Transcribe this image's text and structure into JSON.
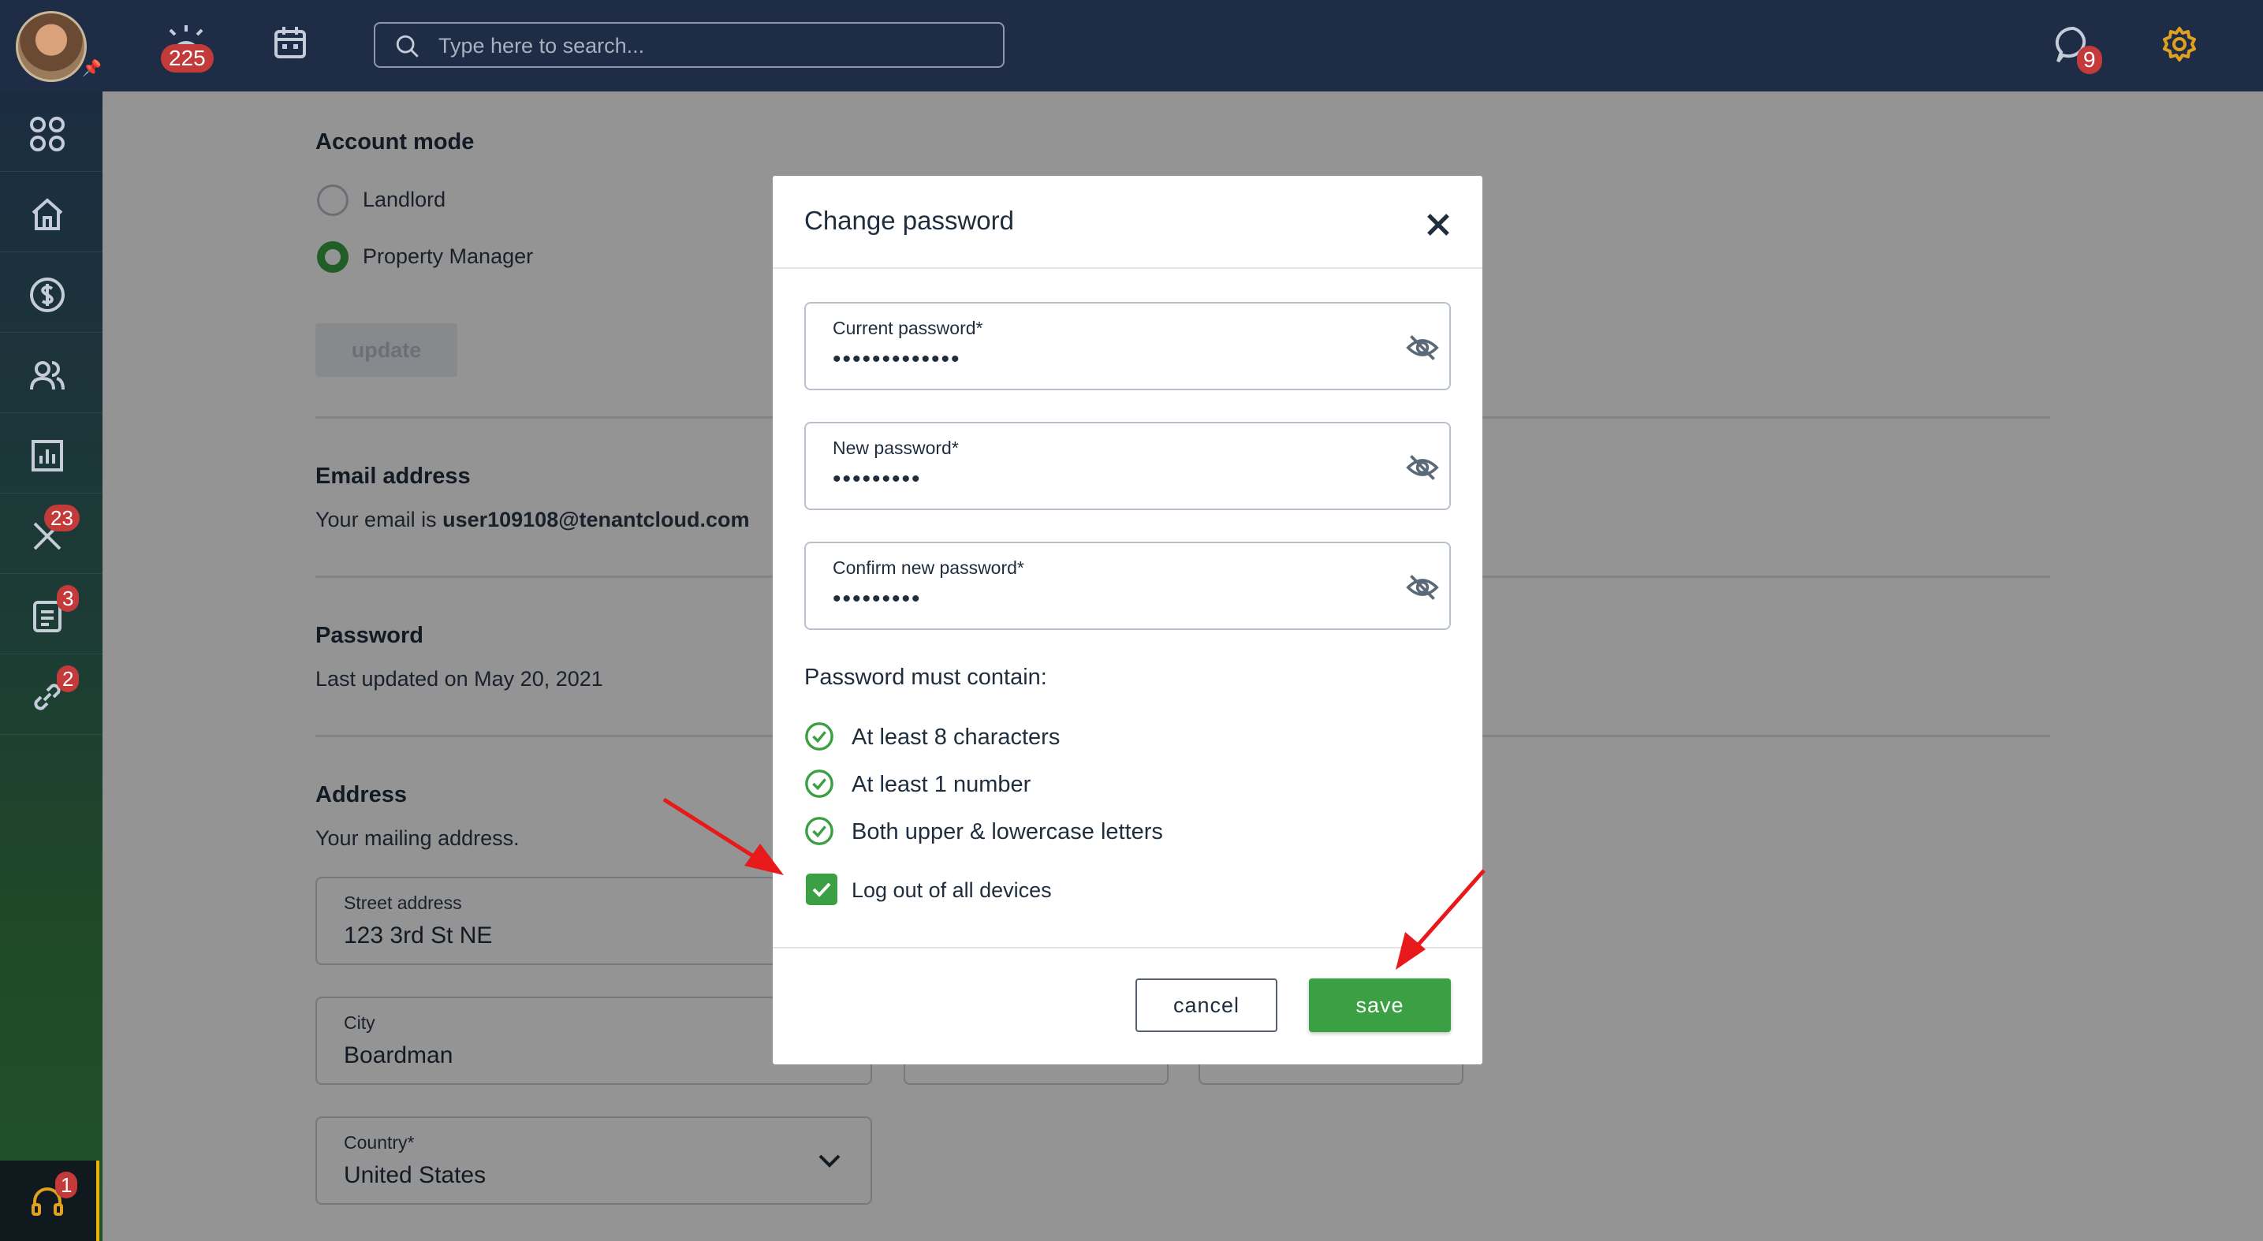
{
  "topbar": {
    "alerts_count": "225",
    "search_placeholder": "Type here to search...",
    "messages_count": "9"
  },
  "sidebar": {
    "maintenance_count": "23",
    "documents_count": "3",
    "links_count": "2",
    "help_count": "1"
  },
  "account_mode": {
    "title": "Account mode",
    "options": [
      "Landlord",
      "Property Manager"
    ],
    "selected": "Property Manager",
    "update_label": "update"
  },
  "email": {
    "title": "Email address",
    "prefix": "Your email is ",
    "value": "user109108@tenantcloud.com"
  },
  "password_section": {
    "title": "Password",
    "last_updated": "Last updated on May 20, 2021"
  },
  "address": {
    "title": "Address",
    "subtitle": "Your mailing address.",
    "street_label": "Street address",
    "street_value": "123 3rd St NE",
    "city_label": "City",
    "city_value": "Boardman",
    "country_label": "Country*",
    "country_value": "United States"
  },
  "modal": {
    "title": "Change password",
    "current_label": "Current password*",
    "current_value": "•••••••••••••",
    "new_label": "New password*",
    "new_value": "•••••••••",
    "confirm_label": "Confirm new password*",
    "confirm_value": "•••••••••",
    "requirements_title": "Password must contain:",
    "requirements": [
      "At least 8 characters",
      "At least 1 number",
      "Both upper & lowercase letters"
    ],
    "logout_label": "Log out of all devices",
    "cancel_label": "cancel",
    "save_label": "save"
  },
  "colors": {
    "topbar": "#1e2d45",
    "accent_green": "#3aa043",
    "badge_red": "#c33a3a",
    "annotation_red": "#e8191b"
  }
}
